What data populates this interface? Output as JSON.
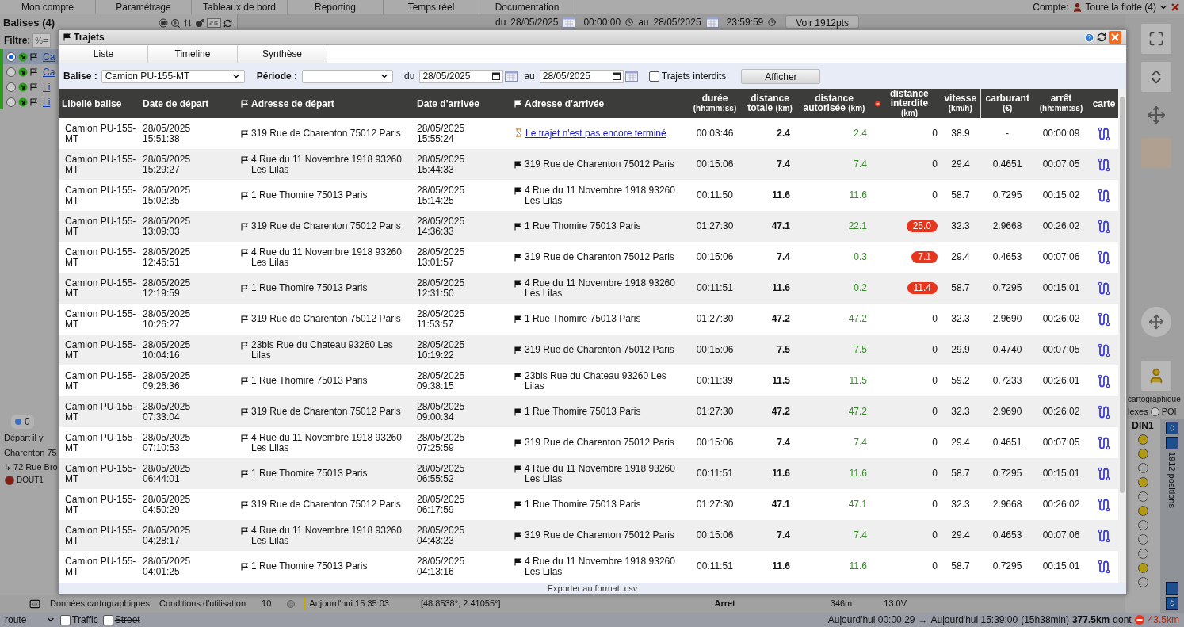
{
  "top_nav": {
    "items": [
      "Mon compte",
      "Paramétrage",
      "Tableaux de bord",
      "Reporting",
      "Temps réel",
      "Documentation"
    ],
    "account_label": "Compte:",
    "account_value": "Toute la flotte (4)"
  },
  "sidebar": {
    "title": "Balises (4)",
    "filter_label": "Filtre:",
    "filter_value": "%=",
    "items": [
      {
        "label": "Ca",
        "selected": true
      },
      {
        "label": "Ca",
        "selected": false
      },
      {
        "label": "Li",
        "selected": false
      },
      {
        "label": "Li",
        "selected": false
      }
    ],
    "badge": "0",
    "route_start": "Départ il y",
    "route_street": "Charenton 75",
    "route_next": "↳ 72 Rue Bro",
    "output": "DOUT1"
  },
  "map_toolbar": {
    "from_label": "du",
    "from_date": "28/05/2025",
    "from_time": "00:00:00",
    "to_label": "au",
    "to_date": "28/05/2025",
    "to_time": "23:59:59",
    "button": "Voir 1912pts"
  },
  "map_footer": {
    "links": [
      "Données cartographiques",
      "Conditions d'utilisation"
    ],
    "map_type": "route",
    "options": [
      {
        "label": "Traffic",
        "checked": false,
        "disabled": false
      },
      {
        "label": "Street",
        "checked": false,
        "disabled": true
      }
    ]
  },
  "positions": {
    "row": {
      "selected": false,
      "index": "10",
      "time": "Aujourd'hui 15:35:03",
      "coords": "[48.8538°, 2.41055°]",
      "event": "Arret",
      "distance": "346m",
      "voltage": "13.0V"
    },
    "column_header": "DIN1",
    "dots": [
      {
        "on": true
      },
      {
        "on": true
      },
      {
        "on": false
      },
      {
        "on": true
      },
      {
        "on": false
      },
      {
        "on": true
      },
      {
        "on": false
      },
      {
        "on": false
      },
      {
        "on": false
      },
      {
        "on": true
      },
      {
        "on": false
      }
    ],
    "count": "1912 positions"
  },
  "map_labels": {
    "attribution": "cartographique",
    "layers": "lexes",
    "poi": "POI",
    "poi_selected": false
  },
  "status_bar": {
    "from": "Aujourd'hui 00:00:29",
    "arrow": "→",
    "to": "Aujourd'hui 15:39:00",
    "duration": "(15h38min)",
    "distance": "377.5km",
    "dont": "dont",
    "forbidden": "43.5km"
  },
  "dialog": {
    "title": "Trajets",
    "tabs": [
      "Liste",
      "Timeline",
      "Synthèse"
    ],
    "filters": {
      "beacon_label": "Balise :",
      "beacon_value": "Camion PU-155-MT",
      "period_label": "Période :",
      "from_label": "du",
      "from_date": "28/05/2025",
      "to_label": "au",
      "to_date": "28/05/2025",
      "forbidden_only": {
        "label": "Trajets interdits",
        "checked": false
      },
      "button": "Afficher"
    },
    "columns": [
      {
        "title": "Libellé balise"
      },
      {
        "title": "Date de départ"
      },
      {
        "title": "Adresse de départ"
      },
      {
        "title": "Date d'arrivée"
      },
      {
        "title": "Adresse d'arrivée"
      },
      {
        "title": "durée",
        "unit": "(hh:mm:ss)"
      },
      {
        "title": "distance totale",
        "unit": "(km)"
      },
      {
        "title": "distance autorisée",
        "unit": "(km)"
      },
      {
        "title": "distance interdite",
        "unit": "(km)"
      },
      {
        "title": "vitesse",
        "unit": "(km/h)"
      },
      {
        "title": "carburant",
        "unit": "(€)"
      },
      {
        "title": "arrêt",
        "unit": "(hh:mm:ss)"
      },
      {
        "title": "carte"
      }
    ],
    "rows": [
      {
        "label": "Camion PU-155-MT",
        "dep_date": "28/05/2025",
        "dep_time": "15:51:38",
        "dep_address": "319 Rue de Charenton 75012 Paris",
        "arr_date": "28/05/2025",
        "arr_time": "15:55:24",
        "arrival": {
          "kind": "pending",
          "text": "Le trajet n'est pas encore terminé"
        },
        "duration": "00:03:46",
        "total": "2.4",
        "allowed": "2.4",
        "forbidden": "0",
        "forbidden_flag": false,
        "speed": "38.9",
        "fuel": "-",
        "stop": "00:00:09"
      },
      {
        "label": "Camion PU-155-MT",
        "dep_date": "28/05/2025",
        "dep_time": "15:29:27",
        "dep_address": "4 Rue du 11 Novembre 1918 93260 Les Lilas",
        "arr_date": "28/05/2025",
        "arr_time": "15:44:33",
        "arrival": {
          "kind": "address",
          "text": "319 Rue de Charenton 75012 Paris"
        },
        "duration": "00:15:06",
        "total": "7.4",
        "allowed": "7.4",
        "forbidden": "0",
        "forbidden_flag": false,
        "speed": "29.4",
        "fuel": "0.4651",
        "stop": "00:07:05"
      },
      {
        "label": "Camion PU-155-MT",
        "dep_date": "28/05/2025",
        "dep_time": "15:02:35",
        "dep_address": "1 Rue Thomire 75013 Paris",
        "arr_date": "28/05/2025",
        "arr_time": "15:14:25",
        "arrival": {
          "kind": "address",
          "text": "4 Rue du 11 Novembre 1918 93260 Les Lilas"
        },
        "duration": "00:11:50",
        "total": "11.6",
        "allowed": "11.6",
        "forbidden": "0",
        "forbidden_flag": false,
        "speed": "58.7",
        "fuel": "0.7295",
        "stop": "00:15:02"
      },
      {
        "label": "Camion PU-155-MT",
        "dep_date": "28/05/2025",
        "dep_time": "13:09:03",
        "dep_address": "319 Rue de Charenton 75012 Paris",
        "arr_date": "28/05/2025",
        "arr_time": "14:36:33",
        "arrival": {
          "kind": "address",
          "text": "1 Rue Thomire 75013 Paris"
        },
        "duration": "01:27:30",
        "total": "47.1",
        "allowed": "22.1",
        "forbidden": "25.0",
        "forbidden_flag": true,
        "speed": "32.3",
        "fuel": "2.9668",
        "stop": "00:26:02"
      },
      {
        "label": "Camion PU-155-MT",
        "dep_date": "28/05/2025",
        "dep_time": "12:46:51",
        "dep_address": "4 Rue du 11 Novembre 1918 93260 Les Lilas",
        "arr_date": "28/05/2025",
        "arr_time": "13:01:57",
        "arrival": {
          "kind": "address",
          "text": "319 Rue de Charenton 75012 Paris"
        },
        "duration": "00:15:06",
        "total": "7.4",
        "allowed": "0.3",
        "forbidden": "7.1",
        "forbidden_flag": true,
        "speed": "29.4",
        "fuel": "0.4653",
        "stop": "00:07:06"
      },
      {
        "label": "Camion PU-155-MT",
        "dep_date": "28/05/2025",
        "dep_time": "12:19:59",
        "dep_address": "1 Rue Thomire 75013 Paris",
        "arr_date": "28/05/2025",
        "arr_time": "12:31:50",
        "arrival": {
          "kind": "address",
          "text": "4 Rue du 11 Novembre 1918 93260 Les Lilas"
        },
        "duration": "00:11:51",
        "total": "11.6",
        "allowed": "0.2",
        "forbidden": "11.4",
        "forbidden_flag": true,
        "speed": "58.7",
        "fuel": "0.7295",
        "stop": "00:15:01"
      },
      {
        "label": "Camion PU-155-MT",
        "dep_date": "28/05/2025",
        "dep_time": "10:26:27",
        "dep_address": "319 Rue de Charenton 75012 Paris",
        "arr_date": "28/05/2025",
        "arr_time": "11:53:57",
        "arrival": {
          "kind": "address",
          "text": "1 Rue Thomire 75013 Paris"
        },
        "duration": "01:27:30",
        "total": "47.2",
        "allowed": "47.2",
        "forbidden": "0",
        "forbidden_flag": false,
        "speed": "32.3",
        "fuel": "2.9690",
        "stop": "00:26:02"
      },
      {
        "label": "Camion PU-155-MT",
        "dep_date": "28/05/2025",
        "dep_time": "10:04:16",
        "dep_address": "23bis Rue du Chateau 93260 Les Lilas",
        "arr_date": "28/05/2025",
        "arr_time": "10:19:22",
        "arrival": {
          "kind": "address",
          "text": "319 Rue de Charenton 75012 Paris"
        },
        "duration": "00:15:06",
        "total": "7.5",
        "allowed": "7.5",
        "forbidden": "0",
        "forbidden_flag": false,
        "speed": "29.9",
        "fuel": "0.4740",
        "stop": "00:07:05"
      },
      {
        "label": "Camion PU-155-MT",
        "dep_date": "28/05/2025",
        "dep_time": "09:26:36",
        "dep_address": "1 Rue Thomire 75013 Paris",
        "arr_date": "28/05/2025",
        "arr_time": "09:38:15",
        "arrival": {
          "kind": "address",
          "text": "23bis Rue du Chateau 93260 Les Lilas"
        },
        "duration": "00:11:39",
        "total": "11.5",
        "allowed": "11.5",
        "forbidden": "0",
        "forbidden_flag": false,
        "speed": "59.2",
        "fuel": "0.7233",
        "stop": "00:26:01"
      },
      {
        "label": "Camion PU-155-MT",
        "dep_date": "28/05/2025",
        "dep_time": "07:33:04",
        "dep_address": "319 Rue de Charenton 75012 Paris",
        "arr_date": "28/05/2025",
        "arr_time": "09:00:34",
        "arrival": {
          "kind": "address",
          "text": "1 Rue Thomire 75013 Paris"
        },
        "duration": "01:27:30",
        "total": "47.2",
        "allowed": "47.2",
        "forbidden": "0",
        "forbidden_flag": false,
        "speed": "32.3",
        "fuel": "2.9690",
        "stop": "00:26:02"
      },
      {
        "label": "Camion PU-155-MT",
        "dep_date": "28/05/2025",
        "dep_time": "07:10:53",
        "dep_address": "4 Rue du 11 Novembre 1918 93260 Les Lilas",
        "arr_date": "28/05/2025",
        "arr_time": "07:25:59",
        "arrival": {
          "kind": "address",
          "text": "319 Rue de Charenton 75012 Paris"
        },
        "duration": "00:15:06",
        "total": "7.4",
        "allowed": "7.4",
        "forbidden": "0",
        "forbidden_flag": false,
        "speed": "29.4",
        "fuel": "0.4651",
        "stop": "00:07:05"
      },
      {
        "label": "Camion PU-155-MT",
        "dep_date": "28/05/2025",
        "dep_time": "06:44:01",
        "dep_address": "1 Rue Thomire 75013 Paris",
        "arr_date": "28/05/2025",
        "arr_time": "06:55:52",
        "arrival": {
          "kind": "address",
          "text": "4 Rue du 11 Novembre 1918 93260 Les Lilas"
        },
        "duration": "00:11:51",
        "total": "11.6",
        "allowed": "11.6",
        "forbidden": "0",
        "forbidden_flag": false,
        "speed": "58.7",
        "fuel": "0.7295",
        "stop": "00:15:01"
      },
      {
        "label": "Camion PU-155-MT",
        "dep_date": "28/05/2025",
        "dep_time": "04:50:29",
        "dep_address": "319 Rue de Charenton 75012 Paris",
        "arr_date": "28/05/2025",
        "arr_time": "06:17:59",
        "arrival": {
          "kind": "address",
          "text": "1 Rue Thomire 75013 Paris"
        },
        "duration": "01:27:30",
        "total": "47.1",
        "allowed": "47.1",
        "forbidden": "0",
        "forbidden_flag": false,
        "speed": "32.3",
        "fuel": "2.9668",
        "stop": "00:26:02"
      },
      {
        "label": "Camion PU-155-MT",
        "dep_date": "28/05/2025",
        "dep_time": "04:28:17",
        "dep_address": "4 Rue du 11 Novembre 1918 93260 Les Lilas",
        "arr_date": "28/05/2025",
        "arr_time": "04:43:23",
        "arrival": {
          "kind": "address",
          "text": "319 Rue de Charenton 75012 Paris"
        },
        "duration": "00:15:06",
        "total": "7.4",
        "allowed": "7.4",
        "forbidden": "0",
        "forbidden_flag": false,
        "speed": "29.4",
        "fuel": "0.4653",
        "stop": "00:07:06"
      },
      {
        "label": "Camion PU-155-MT",
        "dep_date": "28/05/2025",
        "dep_time": "04:01:25",
        "dep_address": "1 Rue Thomire 75013 Paris",
        "arr_date": "28/05/2025",
        "arr_time": "04:13:16",
        "arrival": {
          "kind": "address",
          "text": "4 Rue du 11 Novembre 1918 93260 Les Lilas"
        },
        "duration": "00:11:51",
        "total": "11.6",
        "allowed": "11.6",
        "forbidden": "0",
        "forbidden_flag": false,
        "speed": "58.7",
        "fuel": "0.7295",
        "stop": "00:15:01"
      }
    ],
    "export_link": "Exporter au format .csv"
  }
}
